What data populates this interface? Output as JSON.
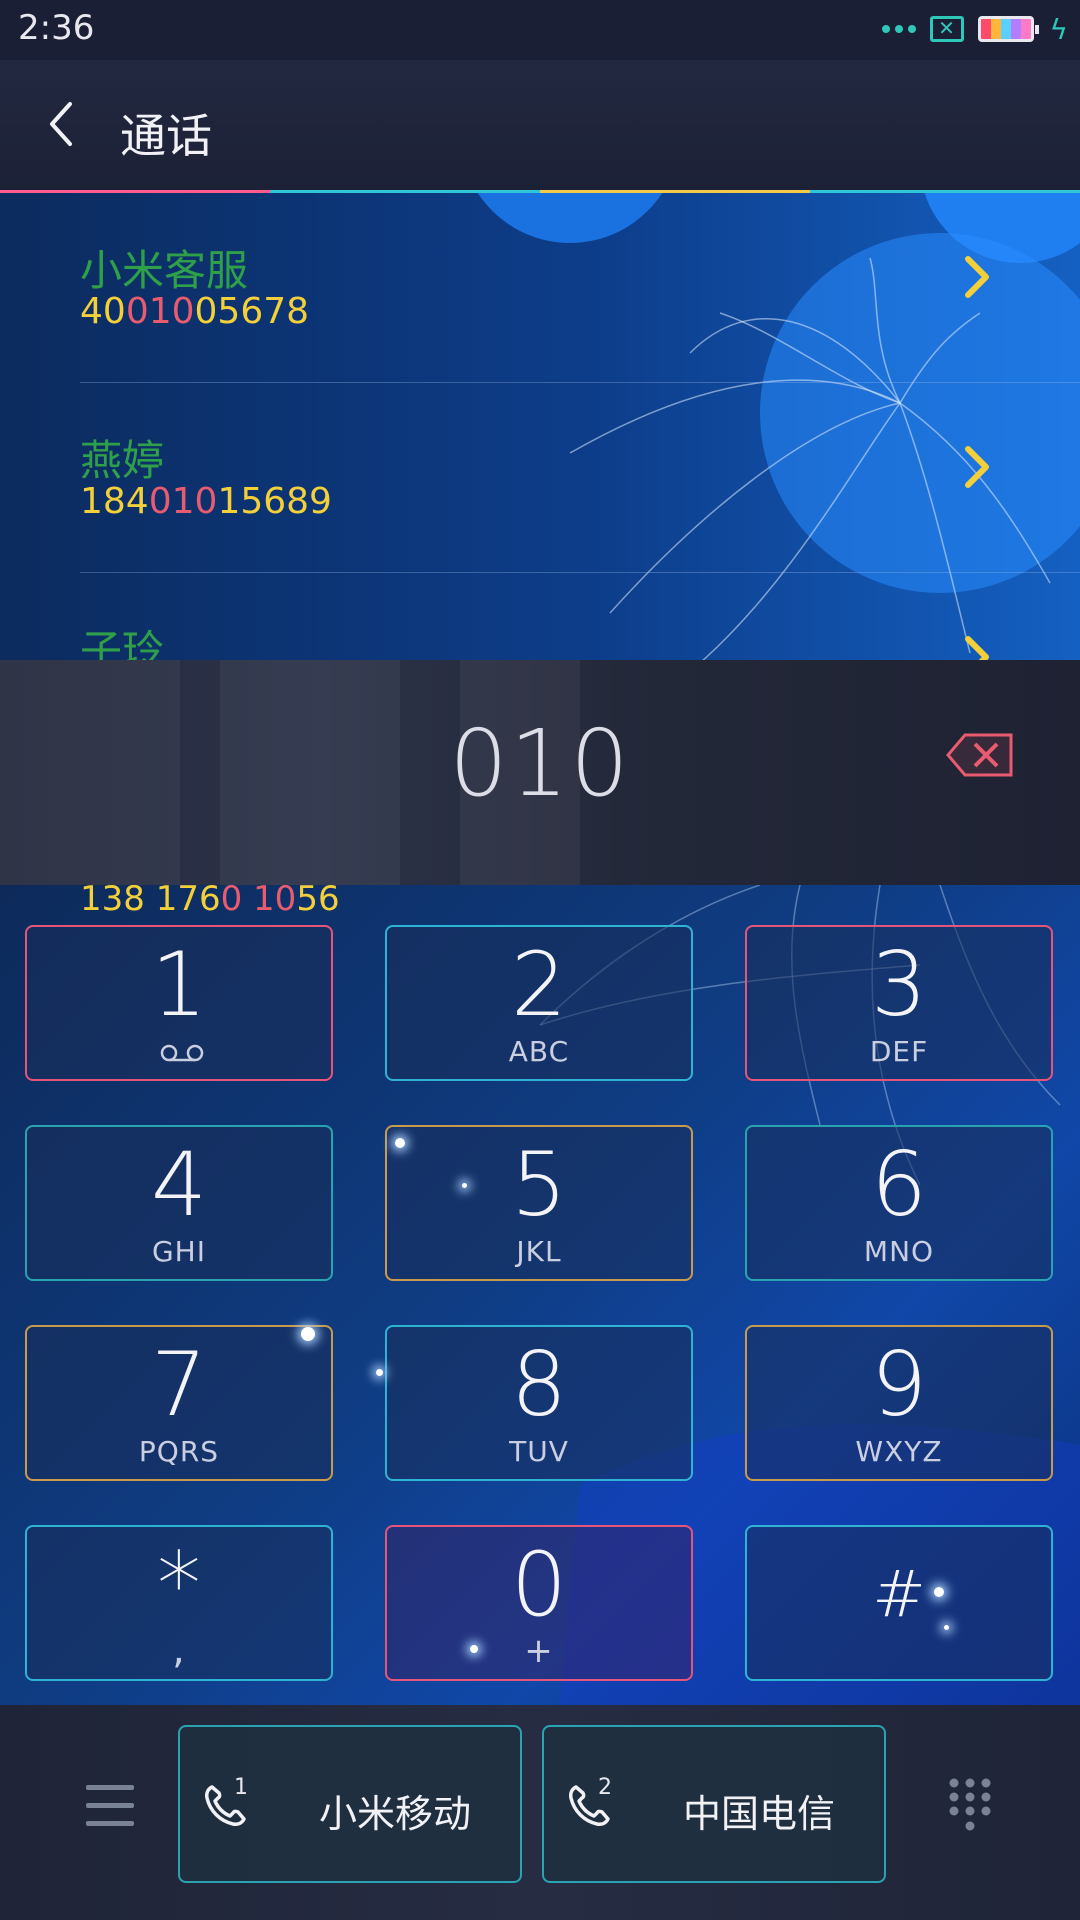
{
  "status_bar": {
    "time": "2:36",
    "icons": [
      "signal-dots-icon",
      "sim-disabled-icon",
      "battery-icon",
      "charging-icon"
    ]
  },
  "header": {
    "title": "通话",
    "back_icon": "chevron-left-icon"
  },
  "contacts": [
    {
      "name": "小米客服",
      "number_parts": [
        "40",
        "010",
        "05678"
      ]
    },
    {
      "name": "燕婷",
      "number_parts": [
        "184",
        "010",
        "15689"
      ]
    },
    {
      "name": "子玲",
      "number_parts": [
        "",
        "",
        ""
      ]
    }
  ],
  "peek_number": {
    "parts": [
      "138 176",
      "0 10",
      "56"
    ]
  },
  "dial": {
    "entered": "010",
    "delete_icon": "backspace-icon"
  },
  "keypad": [
    {
      "digit": "1",
      "letters": "",
      "icon": "voicemail-icon"
    },
    {
      "digit": "2",
      "letters": "ABC"
    },
    {
      "digit": "3",
      "letters": "DEF"
    },
    {
      "digit": "4",
      "letters": "GHI"
    },
    {
      "digit": "5",
      "letters": "JKL"
    },
    {
      "digit": "6",
      "letters": "MNO"
    },
    {
      "digit": "7",
      "letters": "PQRS"
    },
    {
      "digit": "8",
      "letters": "TUV"
    },
    {
      "digit": "9",
      "letters": "WXYZ"
    },
    {
      "digit": "*",
      "letters": ","
    },
    {
      "digit": "0",
      "letters": "+"
    },
    {
      "digit": "#",
      "letters": ""
    }
  ],
  "bottom_bar": {
    "sim1": {
      "index": "1",
      "carrier": "小米移动"
    },
    "sim2": {
      "index": "2",
      "carrier": "中国电信"
    },
    "menu_icon": "hamburger-menu-icon",
    "dialpad_icon": "dialpad-icon"
  },
  "colors": {
    "name_green": "#2fa04a",
    "number_yellow": "#f3cf3a",
    "match_red": "#e95b6e",
    "accent_cyan": "#2fc7b8"
  }
}
